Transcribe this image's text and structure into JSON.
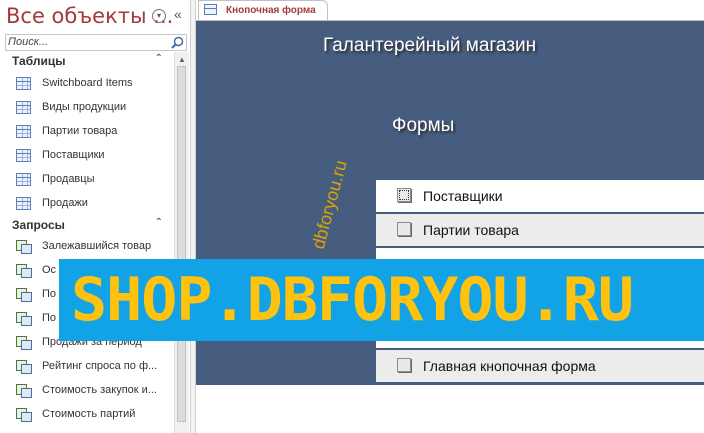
{
  "nav": {
    "title": "Все объекты ...",
    "menu_icon": "circle-chevron-down-icon",
    "collapse_icon": "double-chevron-left-icon",
    "search_placeholder": "Поиск...",
    "groups": [
      {
        "title": "Таблицы",
        "items": [
          "Switchboard Items",
          "Виды продукции",
          "Партии товара",
          "Поставщики",
          "Продавцы",
          "Продажи"
        ]
      },
      {
        "title": "Запросы",
        "items": [
          "Залежавшийся товар",
          "Ос",
          "По",
          "По",
          "Продажи за период",
          "Рейтинг спроса по ф...",
          "Стоимость закупок и...",
          "Стоимость партий"
        ]
      }
    ]
  },
  "document": {
    "tab_label": "Кнопочная форма",
    "form_title": "Галантерейный магазин",
    "form_subtitle": "Формы",
    "buttons": [
      "Поставщики",
      "Партии товара",
      "Главная кнопочная форма"
    ]
  },
  "watermark": {
    "vertical_text": "dbforyou.ru",
    "banner_text": "SHOP.DBFORYOU.RU",
    "banner_color": "#12a3e6",
    "banner_text_color": "#ffc20e",
    "vertical_text_color": "#d9a400"
  },
  "colors": {
    "form_background": "#465d80",
    "accent_text": "#a33b3b"
  }
}
